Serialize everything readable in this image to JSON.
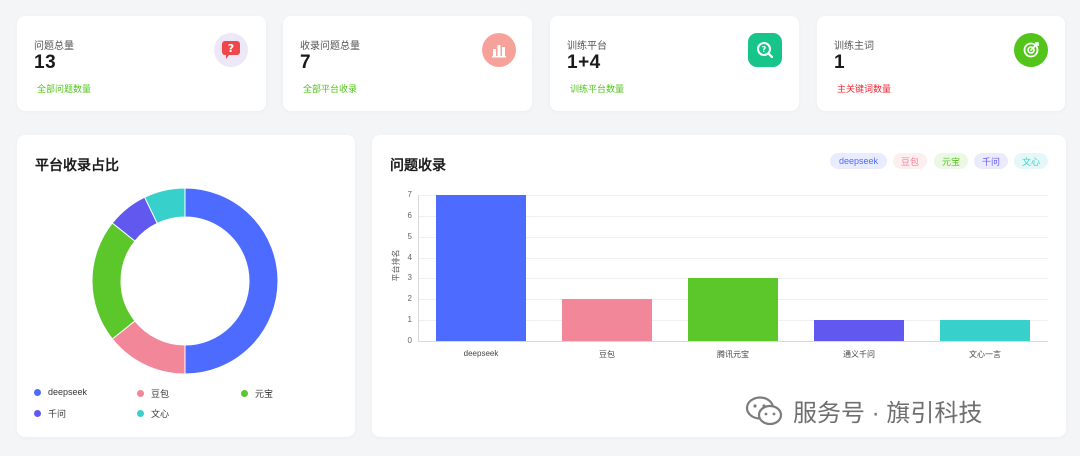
{
  "stats": [
    {
      "label": "问题总量",
      "value": "13",
      "sub": "全部问题数量",
      "sub_color": "#52c41a",
      "icon": "question-chat-icon",
      "icon_bg": "#ece8f7",
      "icon_fg": "#f0474a"
    },
    {
      "label": "收录问题总量",
      "value": "7",
      "sub": "全部平台收录",
      "sub_color": "#52c41a",
      "icon": "bar-chart-icon",
      "icon_bg": "#f6a29b",
      "icon_fg": "#ffffff"
    },
    {
      "label": "训练平台",
      "value": "1+4",
      "sub": "训练平台数量",
      "sub_color": "#52c41a",
      "icon": "search-question-icon",
      "icon_bg": "#17c48a",
      "icon_fg": "#ffffff"
    },
    {
      "label": "训练主词",
      "value": "1",
      "sub": "主关键词数量",
      "sub_color": "#f5222d",
      "icon": "target-icon",
      "icon_bg": "#52c41a",
      "icon_fg": "#ffffff"
    }
  ],
  "pie": {
    "title": "平台收录占比",
    "slices": [
      {
        "name": "deepseek",
        "value": 7,
        "color": "#4e6bff"
      },
      {
        "name": "豆包",
        "value": 2,
        "color": "#f2879a"
      },
      {
        "name": "元宝",
        "value": 3,
        "color": "#5cc72a"
      },
      {
        "name": "千问",
        "value": 1,
        "color": "#6158ef"
      },
      {
        "name": "文心",
        "value": 1,
        "color": "#38d0cb"
      }
    ]
  },
  "bar_panel": {
    "title": "问题收录",
    "tags": [
      {
        "label": "deepseek",
        "bg": "#e9ecff",
        "fg": "#4e6bff"
      },
      {
        "label": "豆包",
        "bg": "#fdeef0",
        "fg": "#f2879a"
      },
      {
        "label": "元宝",
        "bg": "#eaf8e4",
        "fg": "#5cc72a"
      },
      {
        "label": "千问",
        "bg": "#ecebfd",
        "fg": "#6158ef"
      },
      {
        "label": "文心",
        "bg": "#e5f8f7",
        "fg": "#38d0cb"
      }
    ]
  },
  "chart_data": {
    "type": "bar",
    "title": "问题收录",
    "categories": [
      "deepseek",
      "豆包",
      "腾讯元宝",
      "通义千问",
      "文心一言"
    ],
    "values": [
      7,
      2,
      3,
      1,
      1
    ],
    "colors": [
      "#4e6bff",
      "#f2879a",
      "#5cc72a",
      "#6158ef",
      "#38d0cb"
    ],
    "ylabel": "平台排名",
    "ylim": [
      0,
      7
    ],
    "yticks": [
      0,
      1,
      2,
      3,
      4,
      5,
      6,
      7
    ],
    "grid": true
  },
  "watermark": "服务号 · 旗引科技"
}
